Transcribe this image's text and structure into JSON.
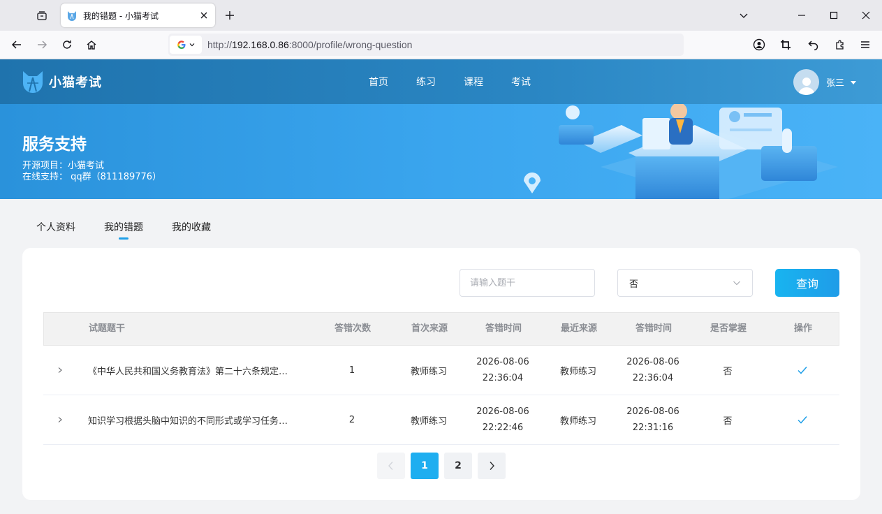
{
  "browser": {
    "tab_title": "我的错题 - 小猫考试",
    "url_prefix": "http://",
    "url_host": "192.168.0.86",
    "url_rest": ":8000/profile/wrong-question"
  },
  "header": {
    "logo_text": "小猫考试",
    "nav": [
      "首页",
      "练习",
      "课程",
      "考试"
    ],
    "user_name": "张三"
  },
  "banner": {
    "title": "服务支持",
    "line1": "开源项目：小猫考试",
    "line2": "在线支持： qq群（811189776）"
  },
  "profile_tabs": [
    "个人资料",
    "我的错题",
    "我的收藏"
  ],
  "active_tab": "我的错题",
  "filter": {
    "search_placeholder": "请输入题干",
    "select_value": "否",
    "query_label": "查询"
  },
  "table": {
    "columns": [
      "试题题干",
      "答错次数",
      "首次来源",
      "答错时间",
      "最近来源",
      "答错时间",
      "是否掌握",
      "操作"
    ],
    "rows": [
      {
        "stem": "《中华人民共和国义务教育法》第二十六条规定…",
        "wrong_count": "1",
        "first_source": "教师练习",
        "first_date": "2026-08-06",
        "first_time": "22:36:04",
        "recent_source": "教师练习",
        "recent_date": "2026-08-06",
        "recent_time": "22:36:04",
        "mastered": "否"
      },
      {
        "stem": "知识学习根据头脑中知识的不同形式或学习任务…",
        "wrong_count": "2",
        "first_source": "教师练习",
        "first_date": "2026-08-06",
        "first_time": "22:22:46",
        "recent_source": "教师练习",
        "recent_date": "2026-08-06",
        "recent_time": "22:31:16",
        "mastered": "否"
      }
    ]
  },
  "pagination": {
    "pages": [
      "1",
      "2"
    ],
    "current": "1"
  },
  "colors": {
    "accent": "#1eaef0",
    "header_bg": "#1f73ad",
    "banner_bg": "#3aa5ee"
  }
}
